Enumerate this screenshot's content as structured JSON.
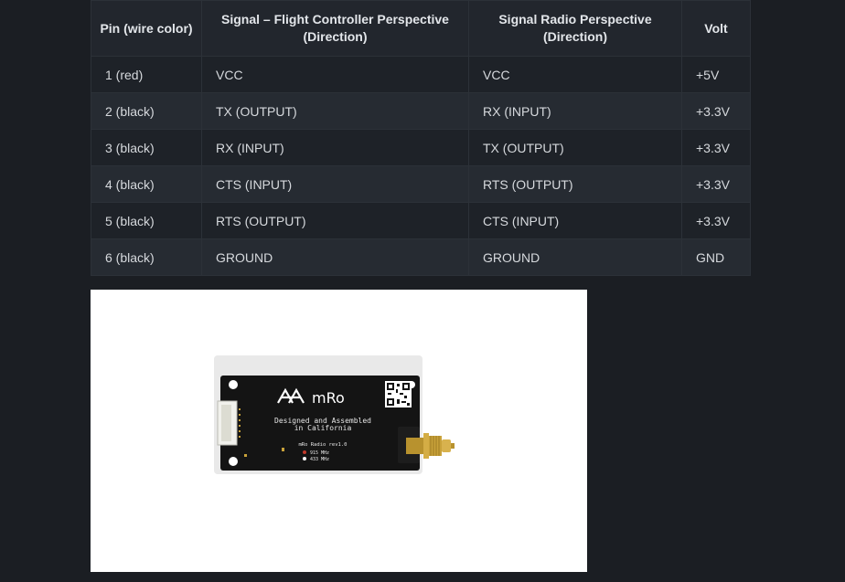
{
  "table": {
    "headers": [
      "Pin (wire color)",
      "Signal – Flight Controller Perspective (Direction)",
      "Signal Radio Perspective (Direction)",
      "Volt"
    ],
    "rows": [
      [
        "1 (red)",
        "VCC",
        "VCC",
        "+5V"
      ],
      [
        "2 (black)",
        "TX (OUTPUT)",
        "RX (INPUT)",
        "+3.3V"
      ],
      [
        "3 (black)",
        "RX (INPUT)",
        "TX (OUTPUT)",
        "+3.3V"
      ],
      [
        "4 (black)",
        "CTS (INPUT)",
        "RTS (OUTPUT)",
        "+3.3V"
      ],
      [
        "5 (black)",
        "RTS (OUTPUT)",
        "CTS (INPUT)",
        "+3.3V"
      ],
      [
        "6 (black)",
        "GROUND",
        "GROUND",
        "GND"
      ]
    ]
  },
  "photo": {
    "brand": "mRo",
    "tagline_1": "Designed and Assembled",
    "tagline_2": "in California",
    "board_rev": "mRo Radio rev1.0",
    "freq_1": "915 MHz",
    "freq_2": "433 MHz"
  },
  "colors": {
    "page_bg": "#1b1e23",
    "header_bg": "#22262d",
    "row_odd": "#1e2228",
    "row_even": "#262b32",
    "pcb": "#141414",
    "connector_gold": "#c9a23a"
  }
}
